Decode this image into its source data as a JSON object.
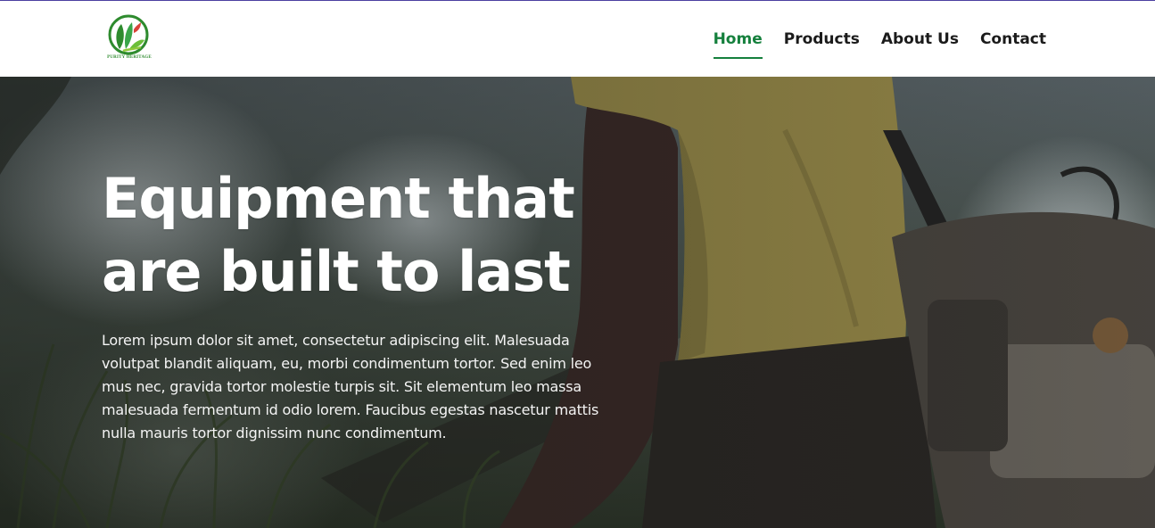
{
  "brand": {
    "logo_text": "PURITY HERITAGE",
    "colors": {
      "leaf_green": "#2e8b2e",
      "leaf_red": "#d9433a",
      "accent": "#15803d"
    }
  },
  "nav": {
    "items": [
      {
        "label": "Home",
        "active": true
      },
      {
        "label": "Products",
        "active": false
      },
      {
        "label": "About Us",
        "active": false
      },
      {
        "label": "Contact",
        "active": false
      }
    ]
  },
  "hero": {
    "title_line1": "Equipment that",
    "title_line2": "are built to last",
    "paragraph": "Lorem ipsum dolor sit amet, consectetur adipiscing elit. Malesuada volutpat blandit aliquam, eu, morbi condimentum tortor. Sed enim leo mus nec, gravida tortor molestie turpis sit. Sit elementum leo massa malesuada fermentum id odio lorem. Faucibus egestas nascetur mattis nulla mauris tortor dignissim nunc condimentum."
  }
}
